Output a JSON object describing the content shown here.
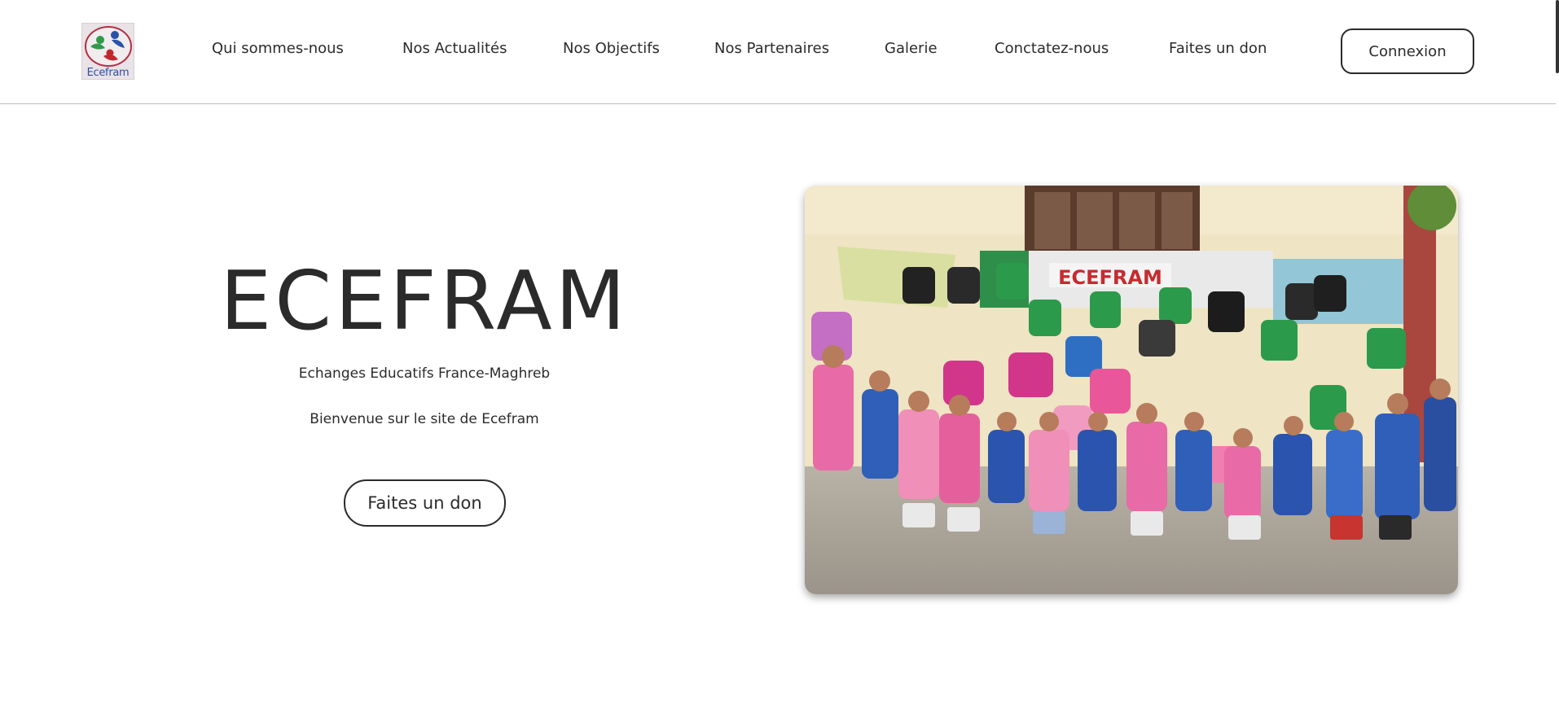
{
  "header": {
    "logo_text": "Ecefram",
    "nav": [
      {
        "label": "Qui sommes-nous"
      },
      {
        "label": "Nos Actualités"
      },
      {
        "label": "Nos Objectifs"
      },
      {
        "label": "Nos Partenaires"
      },
      {
        "label": "Galerie"
      },
      {
        "label": "Conctatez-nous"
      },
      {
        "label": "Faites un don"
      }
    ],
    "login_label": "Connexion"
  },
  "hero": {
    "title": "ECEFRAM",
    "subtitle": "Echanges Educatifs France-Maghreb",
    "welcome": "Bienvenue sur le site de Ecefram",
    "donate_label": "Faites un don",
    "photo_banner_text": "ECEFRAM"
  }
}
